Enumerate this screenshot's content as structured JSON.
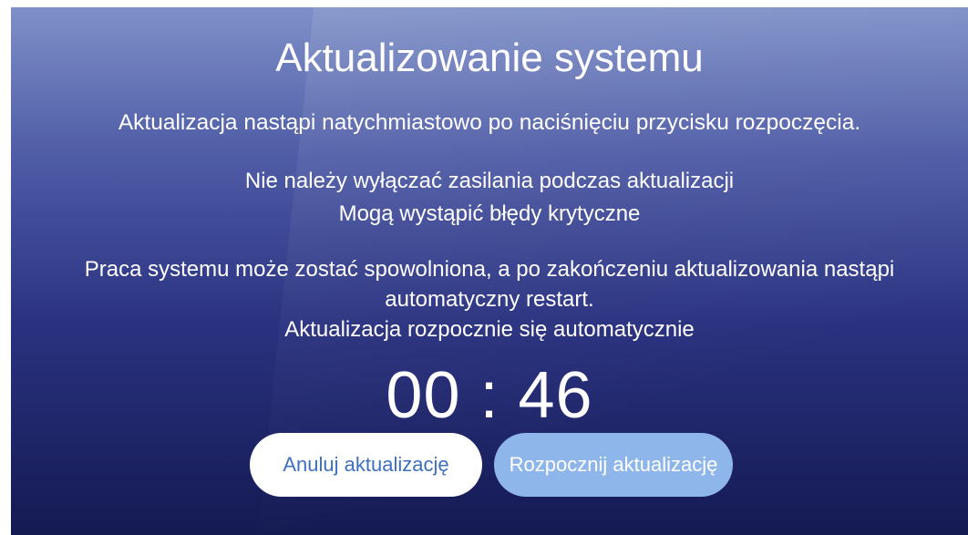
{
  "dialog": {
    "title": "Aktualizowanie systemu",
    "line_start_info": "Aktualizacja nastąpi natychmiastowo po naciśnięciu przycisku rozpoczęcia.",
    "line_power_warning": "Nie należy wyłączać zasilania podczas aktualizacji",
    "line_critical_errors": "Mogą wystąpić błędy krytyczne",
    "line_slowdown": "Praca systemu może zostać spowolniona, a po zakończeniu aktualizowania nastąpi",
    "line_restart": "automatyczny restart.",
    "line_auto_start": "Aktualizacja rozpocznie się automatycznie",
    "countdown": "00 : 46"
  },
  "buttons": {
    "cancel_label": "Anuluj aktualizację",
    "start_label": "Rozpocznij aktualizację"
  },
  "colors": {
    "background_top": "#7e90c8",
    "background_bottom": "#141a52",
    "cancel_button_bg": "#ffffff",
    "cancel_button_text": "#3d6fc0",
    "start_button_bg": "#8fb6ea"
  }
}
